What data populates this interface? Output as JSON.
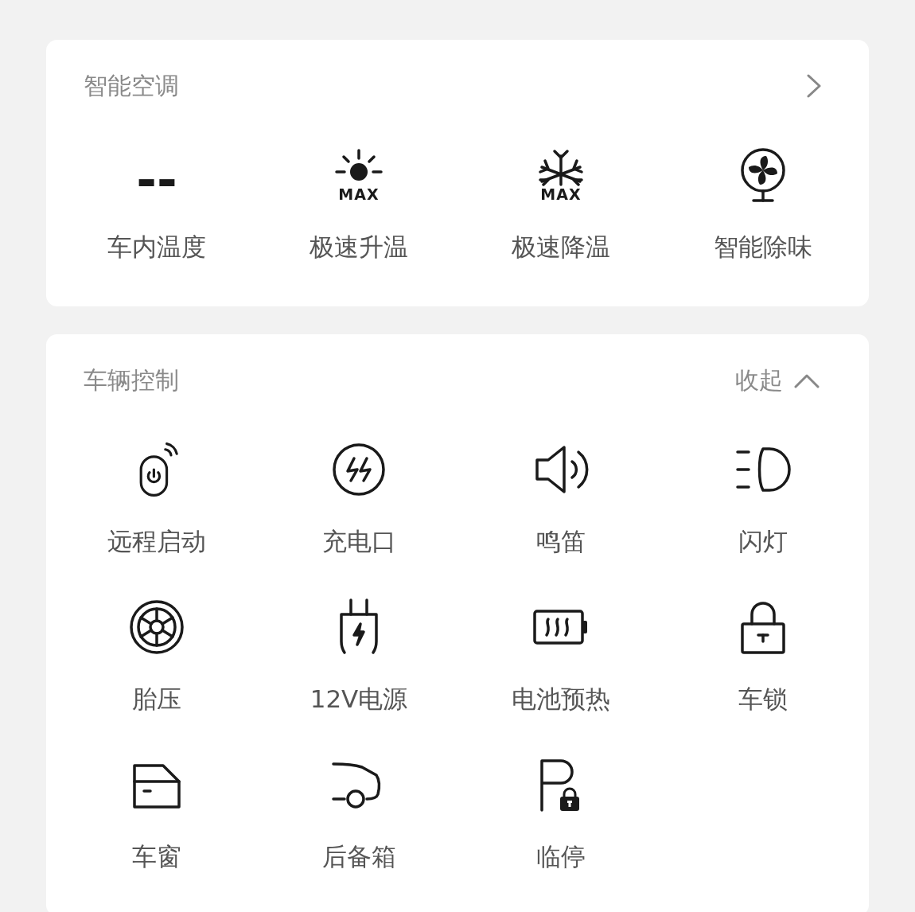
{
  "sections": [
    {
      "title": "智能空调",
      "kind": "link",
      "items": [
        {
          "kind": "reading",
          "value": "--",
          "label": "车内温度"
        },
        {
          "kind": "sun",
          "badge": "MAX",
          "label": "极速升温"
        },
        {
          "kind": "snow",
          "badge": "MAX",
          "label": "极速降温"
        },
        {
          "kind": "fan",
          "label": "智能除味"
        }
      ]
    },
    {
      "title": "车辆控制",
      "kind": "collapse",
      "action": "收起",
      "items": [
        {
          "kind": "remote",
          "label": "远程启动"
        },
        {
          "kind": "port",
          "label": "充电口"
        },
        {
          "kind": "horn",
          "label": "鸣笛"
        },
        {
          "kind": "light",
          "label": "闪灯"
        },
        {
          "kind": "tire",
          "label": "胎压"
        },
        {
          "kind": "plug",
          "label": "12V电源"
        },
        {
          "kind": "battery",
          "label": "电池预热"
        },
        {
          "kind": "lock",
          "label": "车锁"
        },
        {
          "kind": "window",
          "label": "车窗"
        },
        {
          "kind": "trunk",
          "label": "后备箱"
        },
        {
          "kind": "parking",
          "label": "临停"
        }
      ]
    }
  ]
}
